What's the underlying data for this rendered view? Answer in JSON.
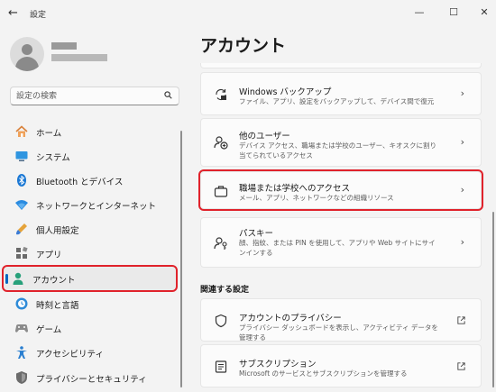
{
  "window": {
    "title": "設定",
    "controls": [
      "minimize-icon",
      "maximize-icon",
      "close-icon"
    ]
  },
  "search": {
    "placeholder": "設定の検索"
  },
  "sidebar": {
    "items": [
      {
        "label": "ホーム",
        "icon": "home-icon"
      },
      {
        "label": "システム",
        "icon": "monitor-icon"
      },
      {
        "label": "Bluetooth とデバイス",
        "icon": "bluetooth-icon"
      },
      {
        "label": "ネットワークとインターネット",
        "icon": "wifi-icon"
      },
      {
        "label": "個人用設定",
        "icon": "brush-icon"
      },
      {
        "label": "アプリ",
        "icon": "apps-icon"
      },
      {
        "label": "アカウント",
        "icon": "person-icon",
        "selected": true
      },
      {
        "label": "時刻と言語",
        "icon": "clock-globe-icon"
      },
      {
        "label": "ゲーム",
        "icon": "gamepad-icon"
      },
      {
        "label": "アクセシビリティ",
        "icon": "accessibility-icon"
      },
      {
        "label": "プライバシーとセキュリティ",
        "icon": "shield-icon"
      }
    ]
  },
  "main": {
    "title": "アカウント",
    "cards": [
      {
        "title": "Windows バックアップ",
        "desc": "ファイル、アプリ、設定をバックアップして、デバイス間で復元",
        "icon": "backup-icon",
        "action": "chevron"
      },
      {
        "title": "他のユーザー",
        "desc": "デバイス アクセス、職場または学校のユーザー、キオスクに割り当てられているアクセス",
        "icon": "add-user-icon",
        "action": "chevron"
      },
      {
        "title": "職場または学校へのアクセス",
        "desc": "メール、アプリ、ネットワークなどの組織リソース",
        "icon": "briefcase-icon",
        "action": "chevron"
      },
      {
        "title": "パスキー",
        "desc": "顔、指紋、または PIN を使用して、アプリや Web サイトにサインインする",
        "icon": "passkey-icon",
        "action": "chevron"
      }
    ],
    "related_label": "関連する設定",
    "related": [
      {
        "title": "アカウントのプライバシー",
        "desc": "プライバシー ダッシュボードを表示し、アクティビティ データを管理する",
        "icon": "shield-icon",
        "action": "external"
      },
      {
        "title": "サブスクリプション",
        "desc": "Microsoft のサービスとサブスクリプションを管理する",
        "icon": "subscription-icon",
        "action": "external"
      }
    ]
  },
  "colors": {
    "accent": "#0067c0",
    "highlight": "#e0222b"
  }
}
